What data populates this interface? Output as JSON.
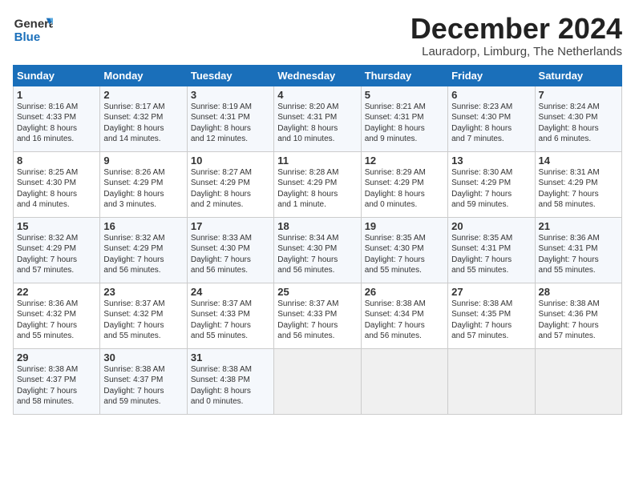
{
  "header": {
    "logo_general": "General",
    "logo_blue": "Blue",
    "month_title": "December 2024",
    "location": "Lauradorp, Limburg, The Netherlands"
  },
  "days_of_week": [
    "Sunday",
    "Monday",
    "Tuesday",
    "Wednesday",
    "Thursday",
    "Friday",
    "Saturday"
  ],
  "weeks": [
    [
      {
        "day": "1",
        "lines": [
          "Sunrise: 8:16 AM",
          "Sunset: 4:33 PM",
          "Daylight: 8 hours",
          "and 16 minutes."
        ]
      },
      {
        "day": "2",
        "lines": [
          "Sunrise: 8:17 AM",
          "Sunset: 4:32 PM",
          "Daylight: 8 hours",
          "and 14 minutes."
        ]
      },
      {
        "day": "3",
        "lines": [
          "Sunrise: 8:19 AM",
          "Sunset: 4:31 PM",
          "Daylight: 8 hours",
          "and 12 minutes."
        ]
      },
      {
        "day": "4",
        "lines": [
          "Sunrise: 8:20 AM",
          "Sunset: 4:31 PM",
          "Daylight: 8 hours",
          "and 10 minutes."
        ]
      },
      {
        "day": "5",
        "lines": [
          "Sunrise: 8:21 AM",
          "Sunset: 4:31 PM",
          "Daylight: 8 hours",
          "and 9 minutes."
        ]
      },
      {
        "day": "6",
        "lines": [
          "Sunrise: 8:23 AM",
          "Sunset: 4:30 PM",
          "Daylight: 8 hours",
          "and 7 minutes."
        ]
      },
      {
        "day": "7",
        "lines": [
          "Sunrise: 8:24 AM",
          "Sunset: 4:30 PM",
          "Daylight: 8 hours",
          "and 6 minutes."
        ]
      }
    ],
    [
      {
        "day": "8",
        "lines": [
          "Sunrise: 8:25 AM",
          "Sunset: 4:30 PM",
          "Daylight: 8 hours",
          "and 4 minutes."
        ]
      },
      {
        "day": "9",
        "lines": [
          "Sunrise: 8:26 AM",
          "Sunset: 4:29 PM",
          "Daylight: 8 hours",
          "and 3 minutes."
        ]
      },
      {
        "day": "10",
        "lines": [
          "Sunrise: 8:27 AM",
          "Sunset: 4:29 PM",
          "Daylight: 8 hours",
          "and 2 minutes."
        ]
      },
      {
        "day": "11",
        "lines": [
          "Sunrise: 8:28 AM",
          "Sunset: 4:29 PM",
          "Daylight: 8 hours",
          "and 1 minute."
        ]
      },
      {
        "day": "12",
        "lines": [
          "Sunrise: 8:29 AM",
          "Sunset: 4:29 PM",
          "Daylight: 8 hours",
          "and 0 minutes."
        ]
      },
      {
        "day": "13",
        "lines": [
          "Sunrise: 8:30 AM",
          "Sunset: 4:29 PM",
          "Daylight: 7 hours",
          "and 59 minutes."
        ]
      },
      {
        "day": "14",
        "lines": [
          "Sunrise: 8:31 AM",
          "Sunset: 4:29 PM",
          "Daylight: 7 hours",
          "and 58 minutes."
        ]
      }
    ],
    [
      {
        "day": "15",
        "lines": [
          "Sunrise: 8:32 AM",
          "Sunset: 4:29 PM",
          "Daylight: 7 hours",
          "and 57 minutes."
        ]
      },
      {
        "day": "16",
        "lines": [
          "Sunrise: 8:32 AM",
          "Sunset: 4:29 PM",
          "Daylight: 7 hours",
          "and 56 minutes."
        ]
      },
      {
        "day": "17",
        "lines": [
          "Sunrise: 8:33 AM",
          "Sunset: 4:30 PM",
          "Daylight: 7 hours",
          "and 56 minutes."
        ]
      },
      {
        "day": "18",
        "lines": [
          "Sunrise: 8:34 AM",
          "Sunset: 4:30 PM",
          "Daylight: 7 hours",
          "and 56 minutes."
        ]
      },
      {
        "day": "19",
        "lines": [
          "Sunrise: 8:35 AM",
          "Sunset: 4:30 PM",
          "Daylight: 7 hours",
          "and 55 minutes."
        ]
      },
      {
        "day": "20",
        "lines": [
          "Sunrise: 8:35 AM",
          "Sunset: 4:31 PM",
          "Daylight: 7 hours",
          "and 55 minutes."
        ]
      },
      {
        "day": "21",
        "lines": [
          "Sunrise: 8:36 AM",
          "Sunset: 4:31 PM",
          "Daylight: 7 hours",
          "and 55 minutes."
        ]
      }
    ],
    [
      {
        "day": "22",
        "lines": [
          "Sunrise: 8:36 AM",
          "Sunset: 4:32 PM",
          "Daylight: 7 hours",
          "and 55 minutes."
        ]
      },
      {
        "day": "23",
        "lines": [
          "Sunrise: 8:37 AM",
          "Sunset: 4:32 PM",
          "Daylight: 7 hours",
          "and 55 minutes."
        ]
      },
      {
        "day": "24",
        "lines": [
          "Sunrise: 8:37 AM",
          "Sunset: 4:33 PM",
          "Daylight: 7 hours",
          "and 55 minutes."
        ]
      },
      {
        "day": "25",
        "lines": [
          "Sunrise: 8:37 AM",
          "Sunset: 4:33 PM",
          "Daylight: 7 hours",
          "and 56 minutes."
        ]
      },
      {
        "day": "26",
        "lines": [
          "Sunrise: 8:38 AM",
          "Sunset: 4:34 PM",
          "Daylight: 7 hours",
          "and 56 minutes."
        ]
      },
      {
        "day": "27",
        "lines": [
          "Sunrise: 8:38 AM",
          "Sunset: 4:35 PM",
          "Daylight: 7 hours",
          "and 57 minutes."
        ]
      },
      {
        "day": "28",
        "lines": [
          "Sunrise: 8:38 AM",
          "Sunset: 4:36 PM",
          "Daylight: 7 hours",
          "and 57 minutes."
        ]
      }
    ],
    [
      {
        "day": "29",
        "lines": [
          "Sunrise: 8:38 AM",
          "Sunset: 4:37 PM",
          "Daylight: 7 hours",
          "and 58 minutes."
        ]
      },
      {
        "day": "30",
        "lines": [
          "Sunrise: 8:38 AM",
          "Sunset: 4:37 PM",
          "Daylight: 7 hours",
          "and 59 minutes."
        ]
      },
      {
        "day": "31",
        "lines": [
          "Sunrise: 8:38 AM",
          "Sunset: 4:38 PM",
          "Daylight: 8 hours",
          "and 0 minutes."
        ]
      },
      {
        "day": "",
        "lines": []
      },
      {
        "day": "",
        "lines": []
      },
      {
        "day": "",
        "lines": []
      },
      {
        "day": "",
        "lines": []
      }
    ]
  ]
}
